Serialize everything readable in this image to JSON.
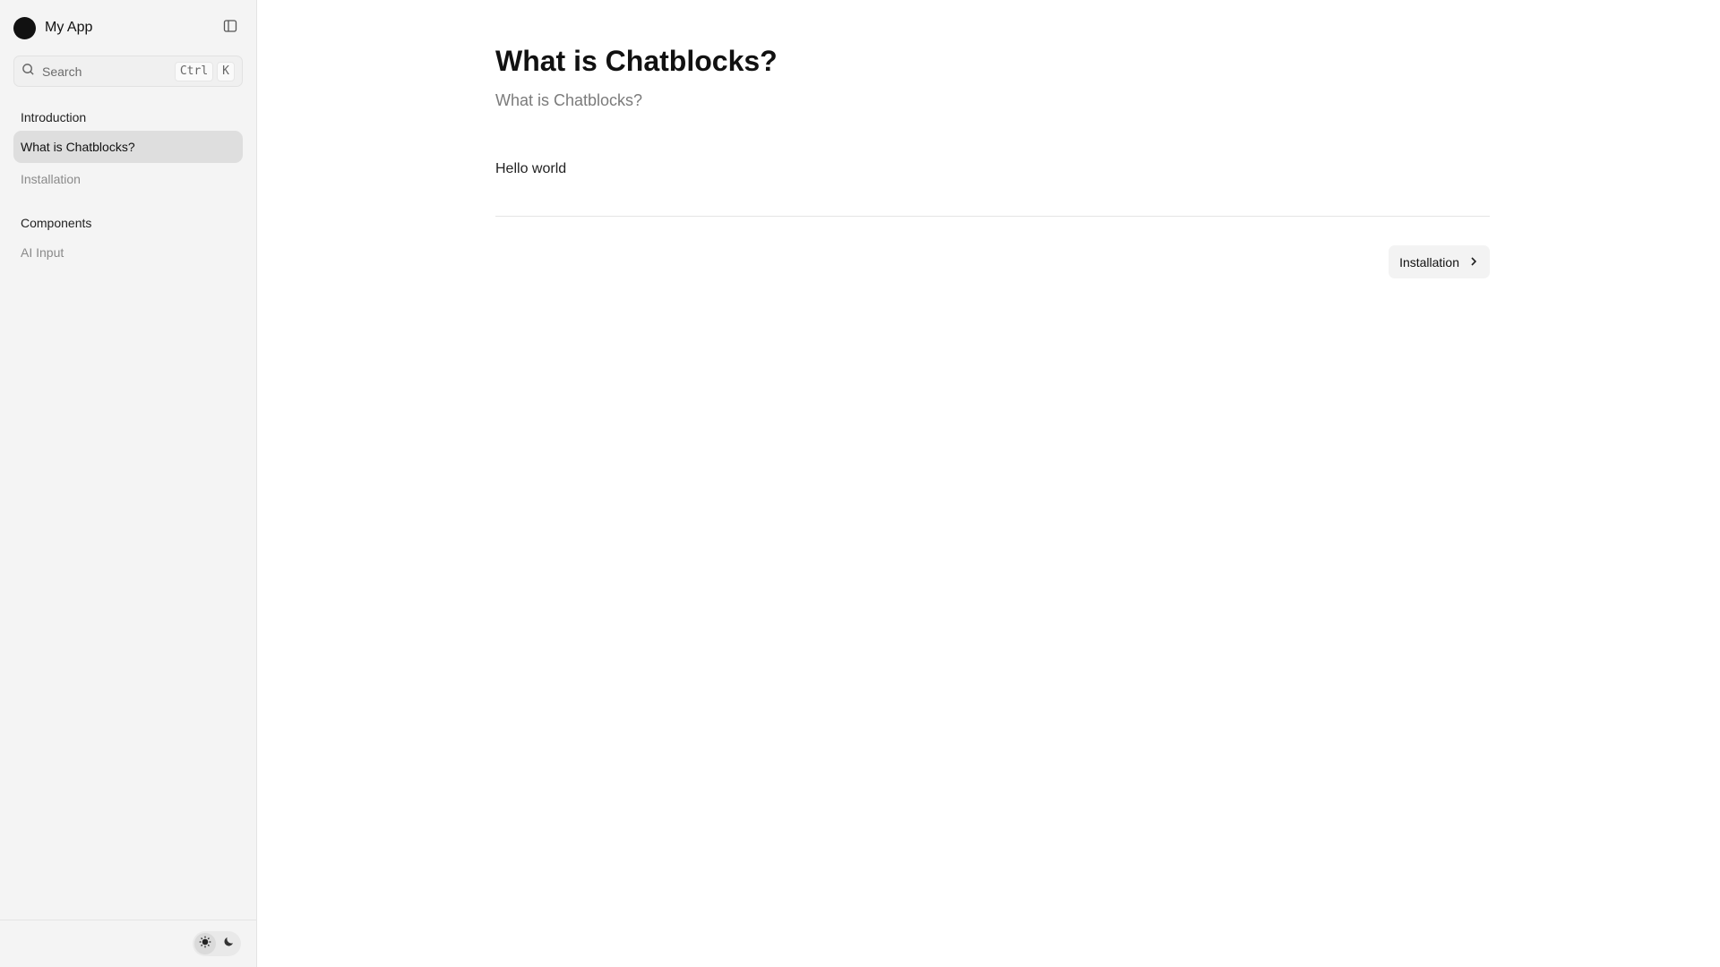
{
  "app": {
    "name": "My App"
  },
  "search": {
    "placeholder": "Search",
    "shortcut_keys": [
      "Ctrl",
      "K"
    ]
  },
  "sidebar": {
    "groups": [
      {
        "label": "Introduction",
        "items": [
          {
            "label": "What is Chatblocks?",
            "active": true
          },
          {
            "label": "Installation",
            "active": false
          }
        ]
      },
      {
        "label": "Components",
        "items": [
          {
            "label": "AI Input",
            "active": false
          }
        ]
      }
    ],
    "theme": {
      "selected": "light",
      "options": [
        "sun-icon",
        "moon-icon"
      ]
    }
  },
  "page": {
    "title": "What is Chatblocks?",
    "subtitle": "What is Chatblocks?",
    "body": "Hello world",
    "next_label": "Installation"
  },
  "colors": {
    "sidebar_bg": "#f4f4f4",
    "active_item_bg": "#dedede",
    "muted_text": "#8a8a8a"
  }
}
